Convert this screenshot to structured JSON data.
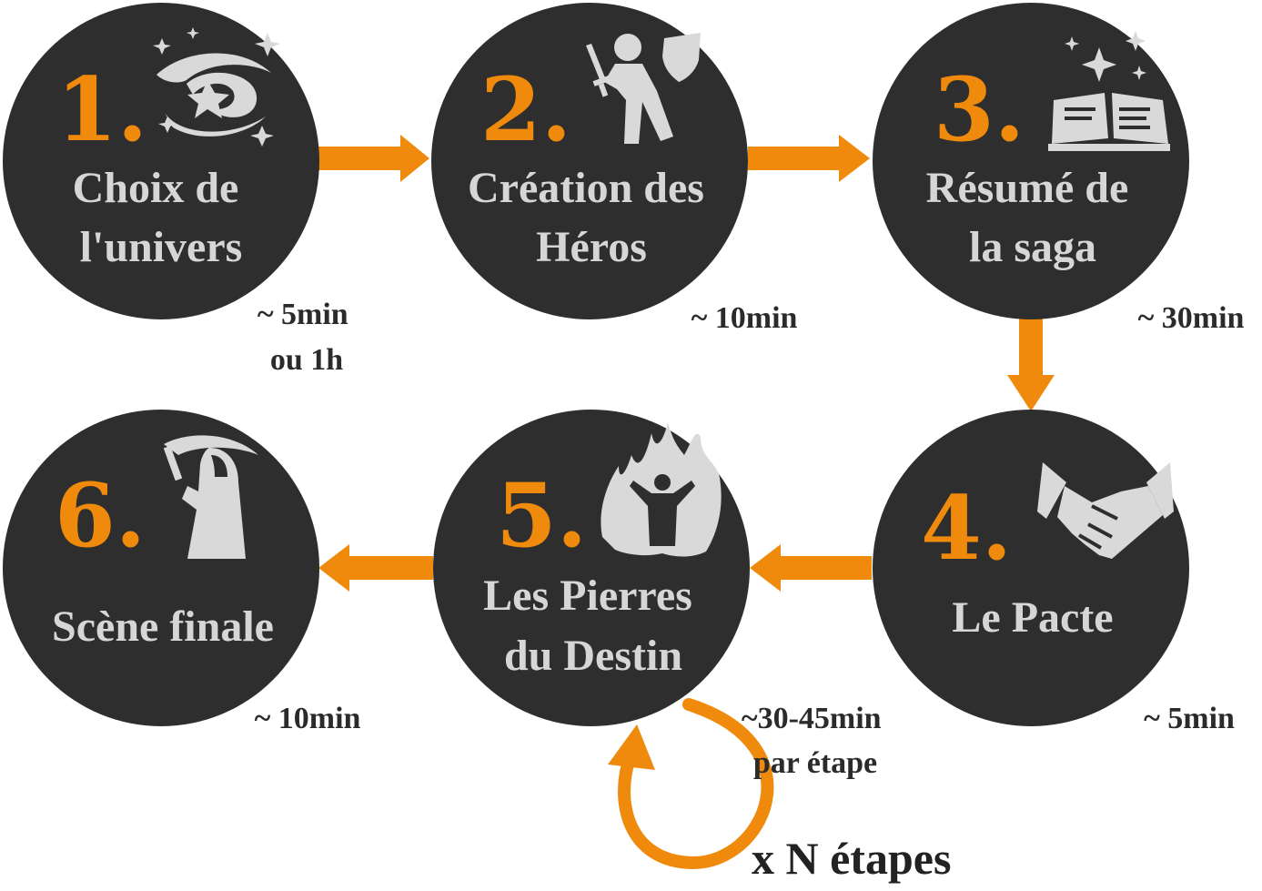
{
  "steps": [
    {
      "number": "1.",
      "title_lines": [
        "Choix de",
        "l'univers"
      ],
      "duration_lines": [
        "~ 5min",
        "ou 1h"
      ],
      "icon": "galaxy-icon"
    },
    {
      "number": "2.",
      "title_lines": [
        "Création des",
        "Héros"
      ],
      "duration_lines": [
        "~ 10min"
      ],
      "icon": "hero-icon"
    },
    {
      "number": "3.",
      "title_lines": [
        "Résumé de",
        "la saga"
      ],
      "duration_lines": [
        "~ 30min"
      ],
      "icon": "book-icon"
    },
    {
      "number": "4.",
      "title_lines": [
        "Le Pacte"
      ],
      "duration_lines": [
        "~ 5min"
      ],
      "icon": "handshake-icon"
    },
    {
      "number": "5.",
      "title_lines": [
        "Les Pierres",
        "du Destin"
      ],
      "duration_lines": [
        "~30-45min",
        "par étape"
      ],
      "icon": "power-figure-icon"
    },
    {
      "number": "6.",
      "title_lines": [
        "Scène finale"
      ],
      "duration_lines": [
        "~ 10min"
      ],
      "icon": "reaper-icon"
    }
  ],
  "loop": {
    "label": "x N étapes",
    "icon": "loop-arrow-icon"
  },
  "colors": {
    "accent": "#ef8a0c",
    "disc": "#2e2e2e",
    "title_text": "#d6d6d6",
    "duration_text": "#2b2b2b"
  }
}
